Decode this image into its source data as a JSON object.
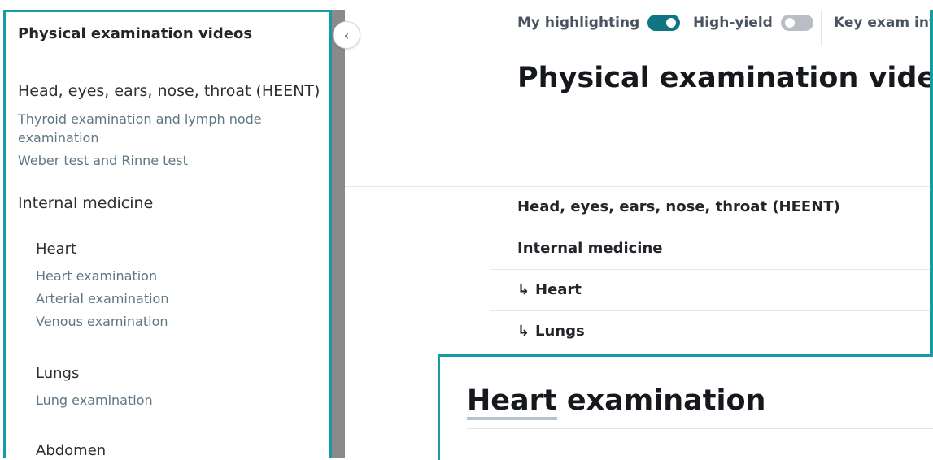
{
  "sidebar": {
    "title": "Physical examination videos",
    "sections": [
      {
        "title": "Head, eyes, ears, nose, throat (HEENT)",
        "links": [
          "Thyroid examination and lymph node",
          "examination",
          "Weber test and Rinne test"
        ]
      },
      {
        "title": "Internal medicine"
      }
    ],
    "subsections": [
      {
        "title": "Heart",
        "links": [
          "Heart examination",
          "Arterial examination",
          "Venous examination"
        ]
      },
      {
        "title": "Lungs",
        "links": [
          "Lung examination"
        ]
      },
      {
        "title": "Abdomen"
      }
    ]
  },
  "collapse_icon": "chevron-left-icon",
  "toolbar": {
    "my_highlighting": "My highlighting",
    "high_yield": "High-yield",
    "key_exam": "Key exam info",
    "my_highlighting_on": true,
    "high_yield_on": false,
    "accent": "#0e7581"
  },
  "main": {
    "title": "Physical examination videos",
    "toc": [
      {
        "label": "Head, eyes, ears, nose, throat (HEENT)",
        "arrow": ""
      },
      {
        "label": "Internal medicine",
        "arrow": ""
      },
      {
        "label": "Heart",
        "arrow": "↳"
      },
      {
        "label": "Lungs",
        "arrow": "↳"
      }
    ]
  },
  "inset": {
    "title_highlight": "Heart",
    "title_rest": " examination"
  },
  "colors": {
    "frame": "#1a9aa6",
    "link": "#5f7684"
  }
}
